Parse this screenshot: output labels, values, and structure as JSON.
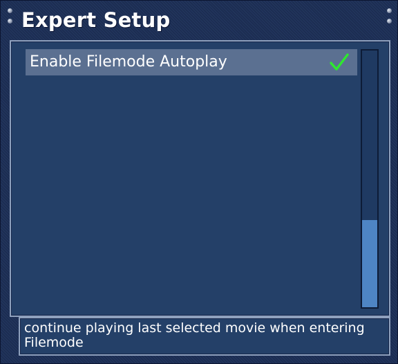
{
  "window": {
    "title": "Expert Setup"
  },
  "list": {
    "items": [
      {
        "label": "Enable Filemode Autoplay",
        "checked": true,
        "selected": true
      }
    ],
    "scroll_position_fraction": 0.66
  },
  "description": {
    "text": "continue playing last selected movie when entering Filemode"
  },
  "colors": {
    "background": "#1f3256",
    "panel": "#244068",
    "selected_row": "#5b7091",
    "check": "#2ee82e",
    "scroll_thumb": "#4e85c4",
    "text": "#ffffff"
  },
  "icons": {
    "check": "checkmark-icon",
    "screw": "screw-icon"
  }
}
